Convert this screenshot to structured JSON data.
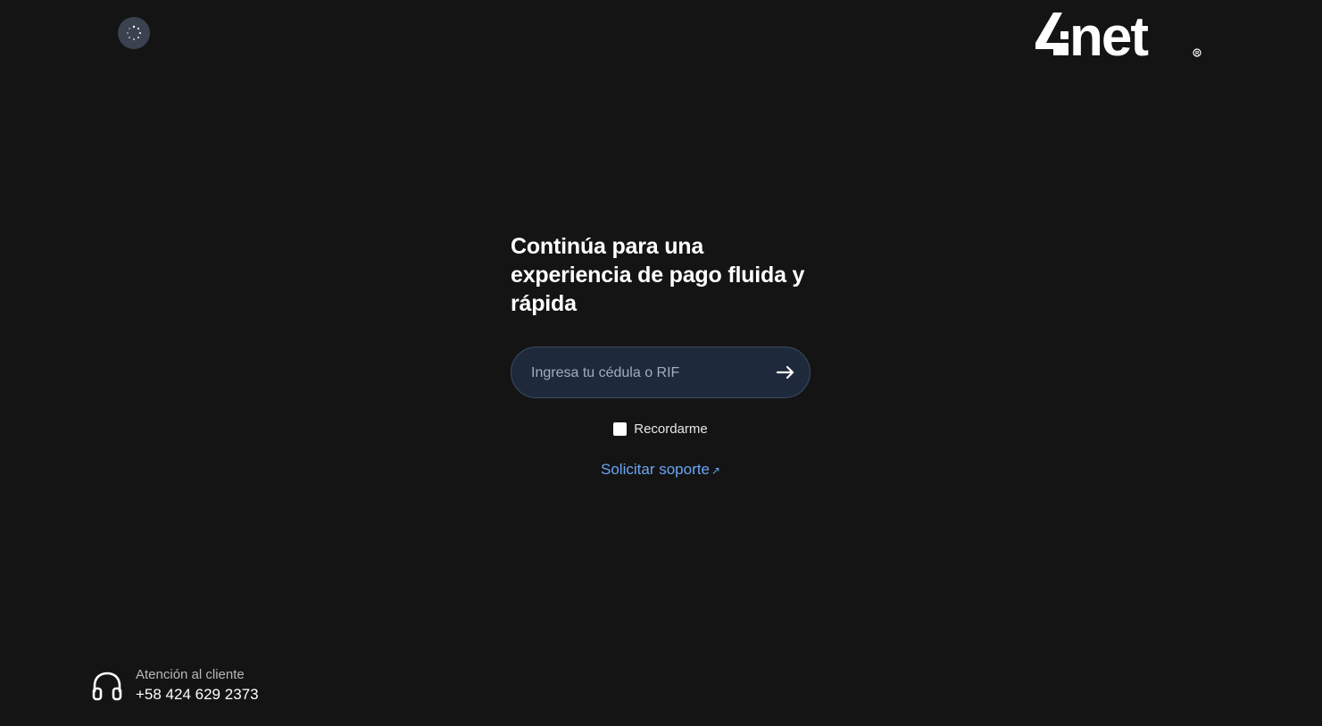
{
  "brand": {
    "logo_text": "4net"
  },
  "main": {
    "headline": "Continúa para una experiencia de pago fluida y rápida",
    "id_input": {
      "placeholder": "Ingresa tu cédula o RIF",
      "value": ""
    },
    "remember_label": "Recordarme",
    "remember_checked": false,
    "support_link": "Solicitar soporte",
    "support_link_icon": "↗"
  },
  "footer": {
    "label": "Atención al cliente",
    "phone": "+58 424 629 2373"
  },
  "icons": {
    "loader": "spinner-icon",
    "submit": "arrow-right-icon",
    "support_external": "external-link-icon",
    "customer_care": "headphones-icon"
  },
  "colors": {
    "background": "#141414",
    "input_background": "#1e2a3b",
    "link": "#6aa6f2",
    "text": "#ffffff"
  }
}
